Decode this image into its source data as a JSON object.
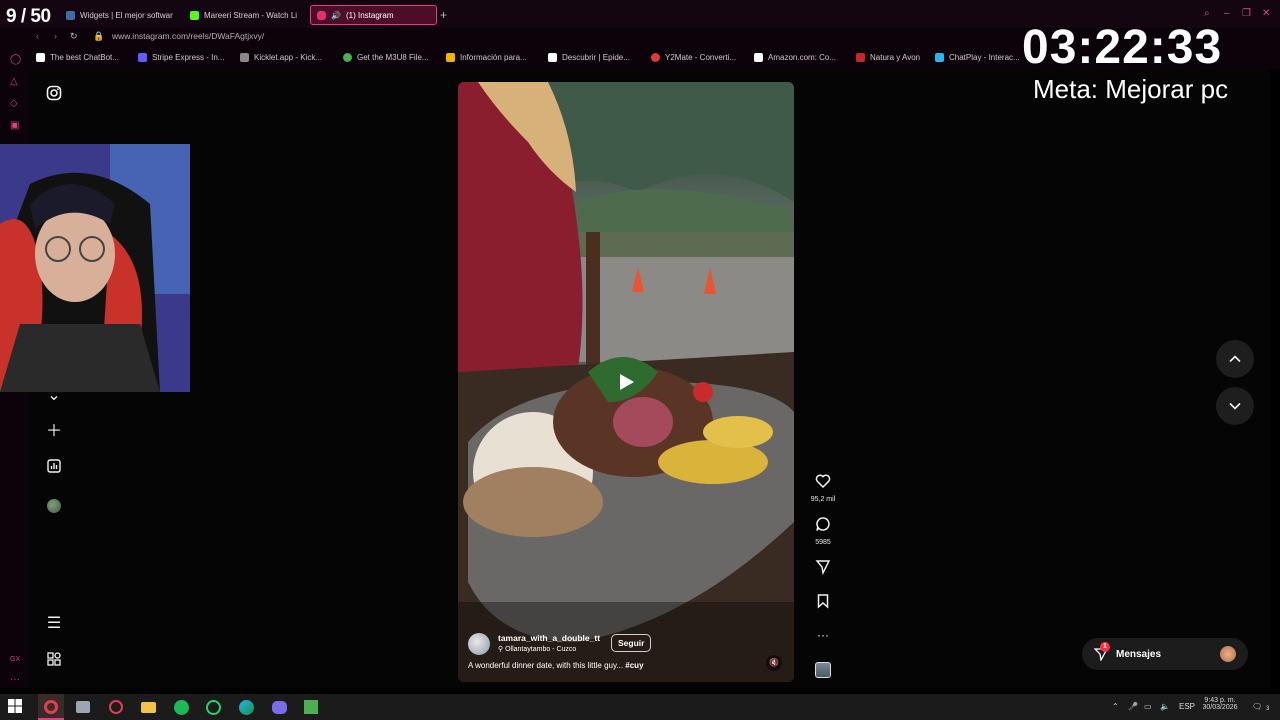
{
  "stream": {
    "counter": "9 / 50",
    "timer": "03:22:33",
    "goal": "Meta: Mejorar pc"
  },
  "tabs": [
    {
      "label": "Widgets | El mejor softwar",
      "color": "#3a6ea5"
    },
    {
      "label": "Mareeri Stream - Watch Li",
      "color": "#53fc18"
    },
    {
      "label": "(1) Instagram",
      "color": "#e1306c"
    }
  ],
  "address": {
    "url": "www.instagram.com/reels/DWaFAgtjxvy/"
  },
  "bookmarks": [
    {
      "label": "The best ChatBot...",
      "color": "#ffffff"
    },
    {
      "label": "Stripe Express - In...",
      "color": "#635bff"
    },
    {
      "label": "Kicklet.app - Kick...",
      "color": "#888888"
    },
    {
      "label": "Get the M3U8 File...",
      "color": "#4caf50"
    },
    {
      "label": "Información para...",
      "color": "#f4b400"
    },
    {
      "label": "Descubrir | Epide...",
      "color": "#ffffff"
    },
    {
      "label": "Y2Mate - Converti...",
      "color": "#e53935"
    },
    {
      "label": "Amazon.com: Co...",
      "color": "#ffffff"
    },
    {
      "label": "Natura y Avon",
      "color": "#c62828"
    },
    {
      "label": "ChatPlay - Interac...",
      "color": "#29b6f6"
    }
  ],
  "reel": {
    "username": "tamara_with_a_double_tt",
    "follow_label": "Seguir",
    "location": "Ollantaytambo - Cuzco",
    "caption": "A wonderful dinner date, with this little guy... ",
    "hashtag": "#cuy",
    "likes": "95,2 mil",
    "comments": "5985"
  },
  "messages": {
    "label": "Mensajes",
    "badge": "1"
  },
  "taskbar": {
    "time": "9:43 p. m.",
    "date": "30/03/2026",
    "lang": "ESP",
    "notif": "3"
  }
}
